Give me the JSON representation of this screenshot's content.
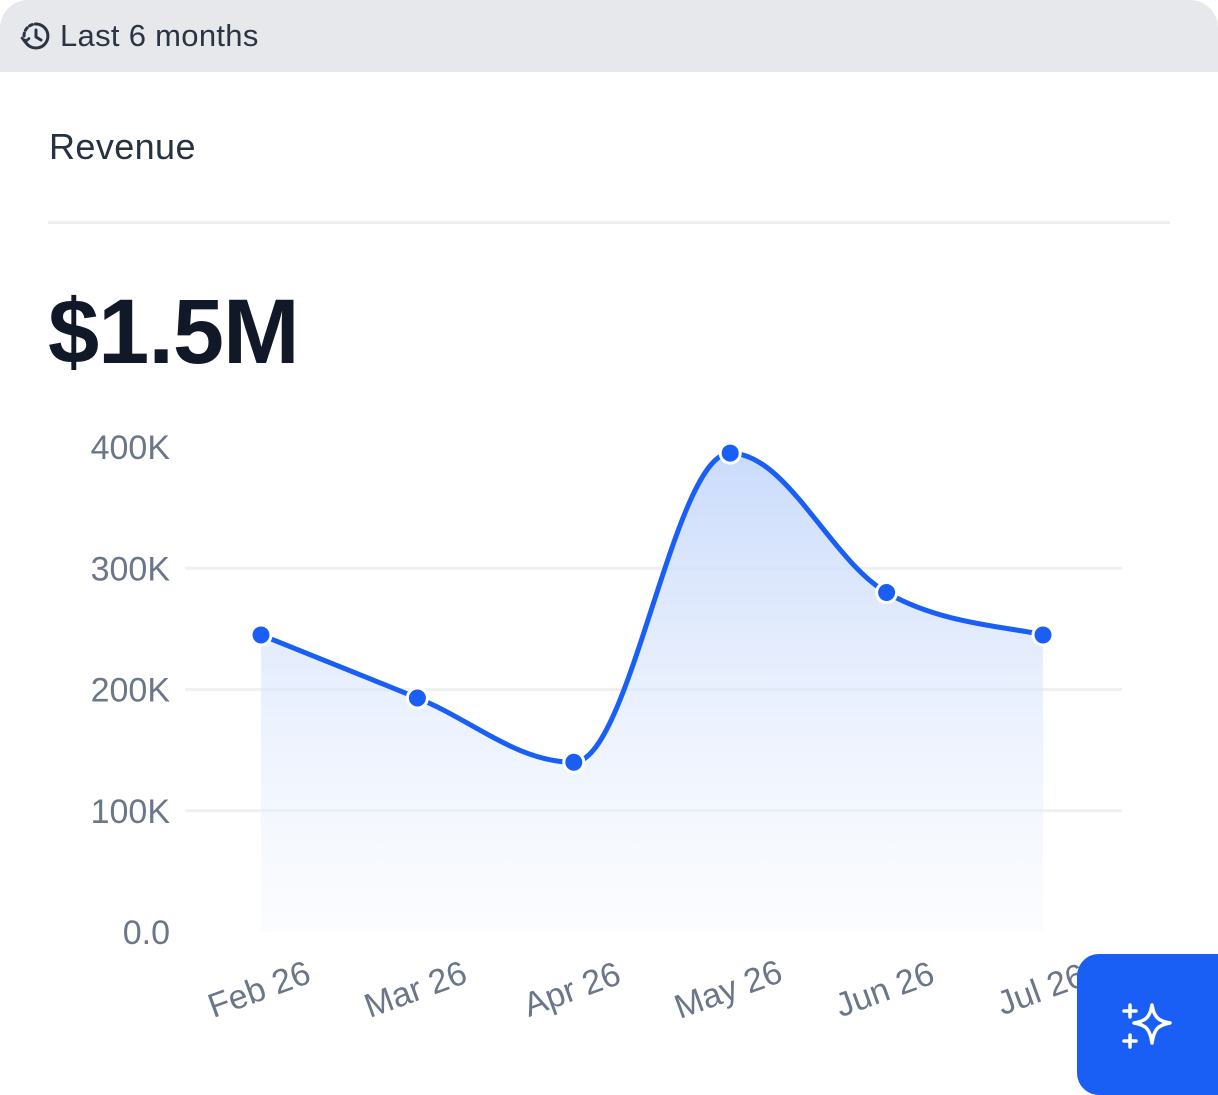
{
  "filter": {
    "range_label": "Last 6 months",
    "icon": "history-clock-icon"
  },
  "card": {
    "title": "Revenue",
    "total": "$1.5M"
  },
  "colors": {
    "line": "#1a5ff5",
    "fill_top": "#c7d9fb",
    "grid": "#eef0f3",
    "tick_text": "#6b7689"
  },
  "ai_button": {
    "icon": "sparkles-icon"
  },
  "chart_data": {
    "type": "area",
    "categories": [
      "Feb 26",
      "Mar 26",
      "Apr 26",
      "May 26",
      "Jun 26",
      "Jul 26"
    ],
    "values": [
      245000,
      193000,
      140000,
      395000,
      280000,
      245000
    ],
    "yticks": [
      "0.0",
      "100K",
      "200K",
      "300K",
      "400K"
    ],
    "ylim": [
      0,
      400000
    ],
    "grid": true,
    "smooth": true
  }
}
